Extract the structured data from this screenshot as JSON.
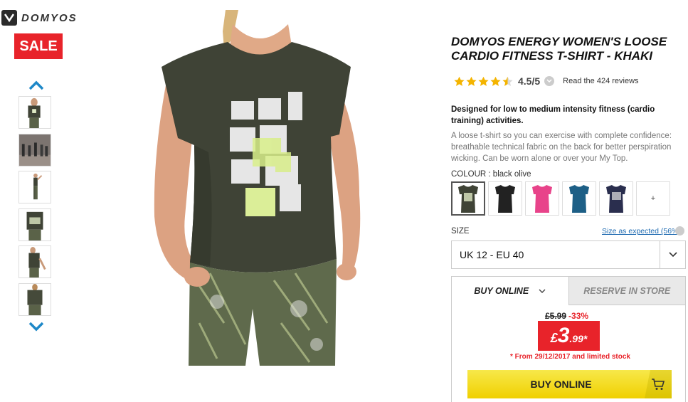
{
  "brand": {
    "logo_text": "DOMYOS",
    "logo_icon": "domyos-logo-icon"
  },
  "badge": {
    "sale_label": "SALE"
  },
  "gallery": {
    "up_icon": "chevron-up-icon",
    "down_icon": "chevron-down-icon",
    "thumbnails": [
      "front-view",
      "gym-class",
      "full-body",
      "front-closeup",
      "side-view",
      "back-view"
    ]
  },
  "product": {
    "title": "DOMYOS ENERGY WOMEN'S LOOSE CARDIO FITNESS T-SHIRT - KHAKI",
    "rating": {
      "stars": 4.5,
      "score_text": "4.5/5",
      "reviews_text": "Read the 424 reviews"
    },
    "summary": "Designed for low to medium intensity fitness (cardio training) activities.",
    "description": "A loose t-shirt so you can exercise with complete confidence: breathable technical fabric on the back for better perspiration wicking. Can be worn alone or over your My Top.",
    "colour": {
      "label": "COLOUR : ",
      "value": "black olive",
      "swatches": [
        "#3f4336",
        "#222222",
        "#e8438a",
        "#1d5f86",
        "#2a2e4e"
      ],
      "more_label": "+"
    },
    "size": {
      "label": "SIZE",
      "link_text": "Size as expected (56%)",
      "selected": "UK 12 - EU 40"
    }
  },
  "buy": {
    "tab_online": "BUY ONLINE",
    "tab_store": "RESERVE IN STORE",
    "old_price": "£5.99",
    "discount": "-33%",
    "price_currency": "£",
    "price_int": "3",
    "price_dec": ".99*",
    "note": "* From 29/12/2017 and limited stock",
    "button_label": "BUY ONLINE"
  },
  "colors": {
    "accent_red": "#e8232a",
    "button_yellow": "#f0d000",
    "link_blue": "#1e6ab0",
    "star": "#f4b400"
  }
}
